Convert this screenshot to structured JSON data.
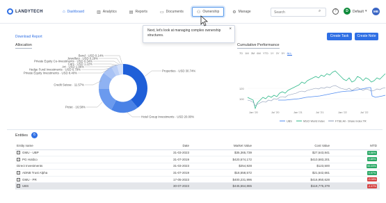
{
  "app": {
    "logo_text": "LANDYTECH"
  },
  "nav": [
    {
      "label": "Dashboard",
      "icon": "home-icon"
    },
    {
      "label": "Analytics",
      "icon": "chart-icon"
    },
    {
      "label": "Reports",
      "icon": "document-icon"
    },
    {
      "label": "Documents",
      "icon": "folder-icon"
    },
    {
      "label": "Ownership",
      "icon": "ownership-icon"
    },
    {
      "label": "Manage",
      "icon": "manage-icon"
    }
  ],
  "header": {
    "search_placeholder": "Search",
    "help": "?",
    "user_initial": "D",
    "user_label": "Default",
    "profile_initials": "MB"
  },
  "tooltip": {
    "text": "Next, let's look at managing complex ownership structures.",
    "close": "×"
  },
  "actions": {
    "download": "Download Report",
    "create_task": "Create Task",
    "create_note": "Create Note"
  },
  "allocation": {
    "title": "Allocation",
    "labels_left": [
      "Bond · USD 0.14%",
      "Jewellery · USD 0.29%",
      "Private Equity Co-Investments · USD 0.34%",
      "Cars · USD 1.22%",
      "Art · USD 1.96%",
      "Hedge Fund Investments · USD 6.79%",
      "Private Equity Investments · USD 8.40%",
      "Credit Suisse · 11.57%",
      "Pictet · 16.58%"
    ],
    "label_right_top": "Properties · USD 30.74%",
    "label_right_bottom": "Hotel Group Investments · USD 20.00%"
  },
  "performance": {
    "title": "Cumulative Performance",
    "ranges": [
      "7D",
      "1M",
      "3M",
      "6M",
      "YTD",
      "1Y",
      "3Y",
      "5Y",
      "ALL"
    ],
    "selected_range": "ALL",
    "y_ticks": [
      "120",
      "100"
    ],
    "x_ticks": [
      "Jan '20",
      "Jul '20",
      "Jan '21",
      "Jul '21",
      "Jan '22",
      "Jul '22"
    ],
    "legend": [
      "UBS",
      "MSCI World Index",
      "FTSE All - Share Index TR"
    ],
    "colors": {
      "ubs": "#4f8bf0",
      "msci": "#2fb98a",
      "ftse": "#8a99b5"
    }
  },
  "entities": {
    "title": "Entities",
    "count": "6",
    "columns": [
      "Entity name",
      "Date",
      "Market Value",
      "Cost Value",
      "MTD"
    ],
    "rows": [
      {
        "name": "GMU - UBP",
        "expand": true,
        "date": "31-03-2023",
        "market": "$35,365,739",
        "cost": "$27,543,841",
        "mtd": "5.86%",
        "mtd_sign": "pos",
        "hl": false
      },
      {
        "name": "PG Holdco",
        "expand": true,
        "date": "31-07-2019",
        "market": "$420,574,172",
        "cost": "$410,583,201",
        "mtd": "0.89%",
        "mtd_sign": "pos",
        "hl": false
      },
      {
        "name": "Direct Investments",
        "expand": false,
        "date": "31-03-2023",
        "market": "$254,928",
        "cost": "$123,500",
        "mtd": "55.69%",
        "mtd_sign": "pos",
        "hl": false
      },
      {
        "name": "ADNB Trust Alpha",
        "expand": true,
        "date": "31-07-2019",
        "market": "$18,558,572",
        "cost": "$21,542,661",
        "mtd": "0.97%",
        "mtd_sign": "pos",
        "hl": false
      },
      {
        "name": "GMU - PR",
        "expand": true,
        "date": "17-05-2023",
        "market": "$400,231,996",
        "cost": "$416,950,628",
        "mtd": "-0.08%",
        "mtd_sign": "neg",
        "hl": false
      },
      {
        "name": "UBS",
        "expand": true,
        "date": "30-07-2023",
        "market": "$445,564,865",
        "cost": "$118,775,379",
        "mtd": "-4.47%",
        "mtd_sign": "neg",
        "hl": true
      }
    ]
  }
}
